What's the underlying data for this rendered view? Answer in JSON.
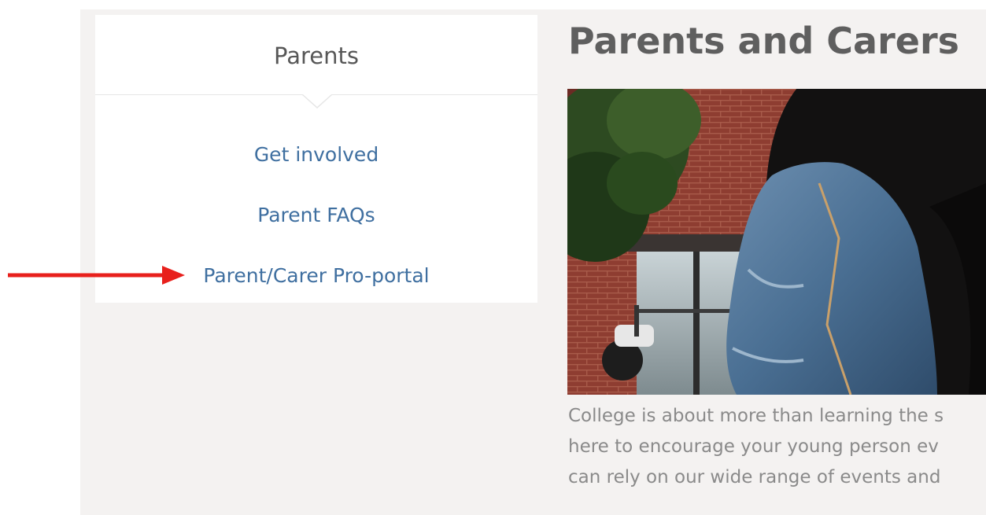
{
  "sidebar": {
    "title": "Parents",
    "links": [
      {
        "label": "Get involved"
      },
      {
        "label": "Parent FAQs"
      },
      {
        "label": "Parent/Carer Pro-portal"
      }
    ]
  },
  "main": {
    "title": "Parents and Carers",
    "intro_lines": [
      "College is about more than learning the s",
      "here to encourage your young person ev",
      "can rely on our wide range of events and"
    ]
  },
  "colors": {
    "link": "#3f6fa0",
    "title": "#5f5f5f",
    "body_text": "#8a8a8a",
    "panel_bg": "#f4f2f1",
    "annotation_arrow": "#e8201c"
  }
}
